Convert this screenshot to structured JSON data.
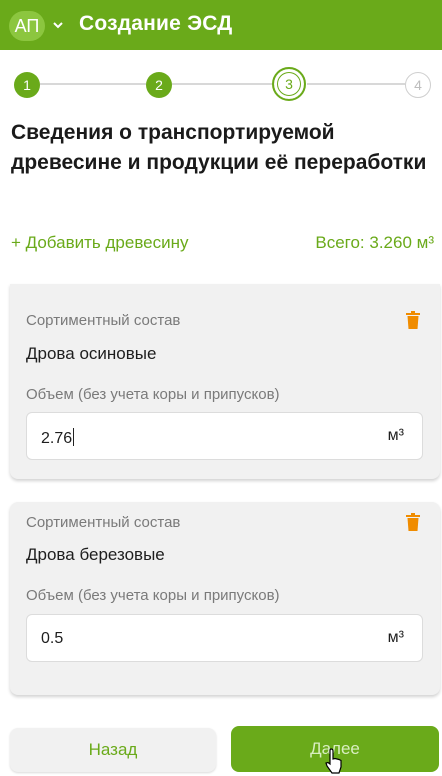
{
  "header": {
    "avatar_text": "АП",
    "title": "Создание ЭСД",
    "accent_color": "#6aaa1a"
  },
  "stepper": {
    "steps": [
      {
        "label": "1",
        "state": "done"
      },
      {
        "label": "2",
        "state": "done"
      },
      {
        "label": "3",
        "state": "current"
      },
      {
        "label": "4",
        "state": "todo"
      }
    ]
  },
  "section_title": "Сведения о транспортируемой древесине и продукции её переработки",
  "add_wood_link": "+ Добавить древесину",
  "total": "Всего: 3.260 м³",
  "items": [
    {
      "assortment_label": "Сортиментный состав",
      "assortment_value": "Дрова осиновые",
      "volume_label": "Объем (без учета коры и припусков)",
      "volume_value": "2.76",
      "unit": "м³"
    },
    {
      "assortment_label": "Сортиментный состав",
      "assortment_value": "Дрова березовые",
      "volume_label": "Объем (без учета коры и припусков)",
      "volume_value": "0.5",
      "unit": "м³"
    }
  ],
  "footer": {
    "back_label": "Назад",
    "next_label": "Далее"
  }
}
